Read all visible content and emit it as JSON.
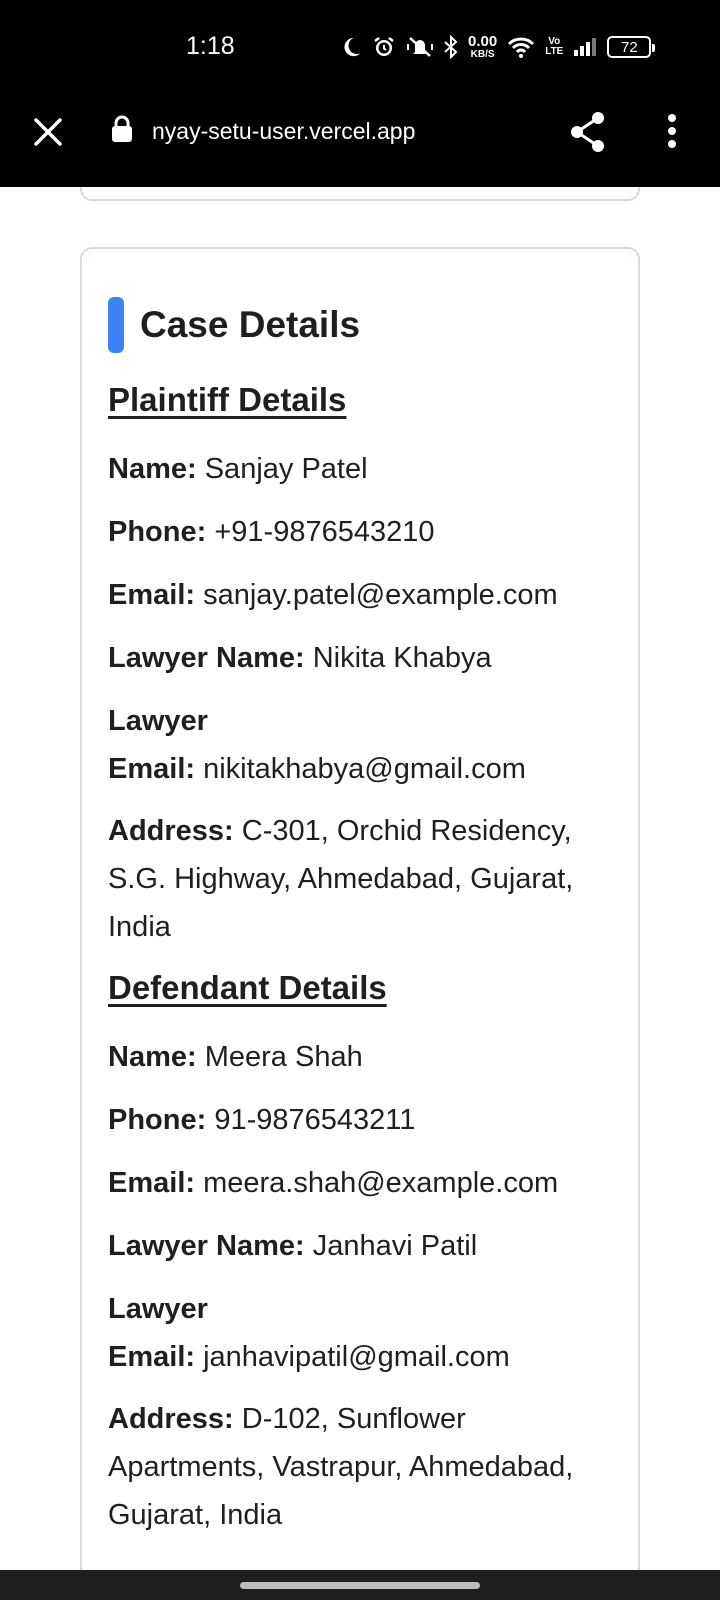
{
  "status_bar": {
    "time": "1:18",
    "net_speed_value": "0.00",
    "net_speed_unit": "KB/S",
    "volte_top": "Vo",
    "volte_bottom": "LTE",
    "battery": "72",
    "icons": [
      "moon-icon",
      "alarm-icon",
      "vibrate-off-icon",
      "bluetooth-icon",
      "wifi-icon",
      "signal-icon",
      "battery-icon"
    ]
  },
  "browser": {
    "url": "nyay-setu-user.vercel.app",
    "icons": [
      "close-icon",
      "lock-icon",
      "share-icon",
      "more-vert-icon"
    ]
  },
  "card": {
    "title": "Case Details",
    "accent_color": "#3b82f6",
    "plaintiff": {
      "heading": "Plaintiff Details",
      "name_label": "Name:",
      "name": "Sanjay Patel",
      "phone_label": "Phone:",
      "phone": "+91-9876543210",
      "email_label": "Email:",
      "email": "sanjay.patel@example.com",
      "lawyer_name_label": "Lawyer Name:",
      "lawyer_name": "Nikita Khabya",
      "lawyer_email_label_1": "Lawyer",
      "lawyer_email_label_2": "Email:",
      "lawyer_email": "nikitakhabya@gmail.com",
      "address_label": "Address:",
      "address": "C-301, Orchid Residency, S.G. Highway, Ahmedabad, Gujarat, India"
    },
    "defendant": {
      "heading": "Defendant Details",
      "name_label": "Name:",
      "name": "Meera Shah",
      "phone_label": "Phone:",
      "phone": "91-9876543211",
      "email_label": "Email:",
      "email": "meera.shah@example.com",
      "lawyer_name_label": "Lawyer Name:",
      "lawyer_name": "Janhavi Patil",
      "lawyer_email_label_1": "Lawyer",
      "lawyer_email_label_2": "Email:",
      "lawyer_email": "janhavipatil@gmail.com",
      "address_label": "Address:",
      "address": "D-102, Sunflower Apartments, Vastrapur, Ahmedabad, Gujarat, India"
    }
  }
}
